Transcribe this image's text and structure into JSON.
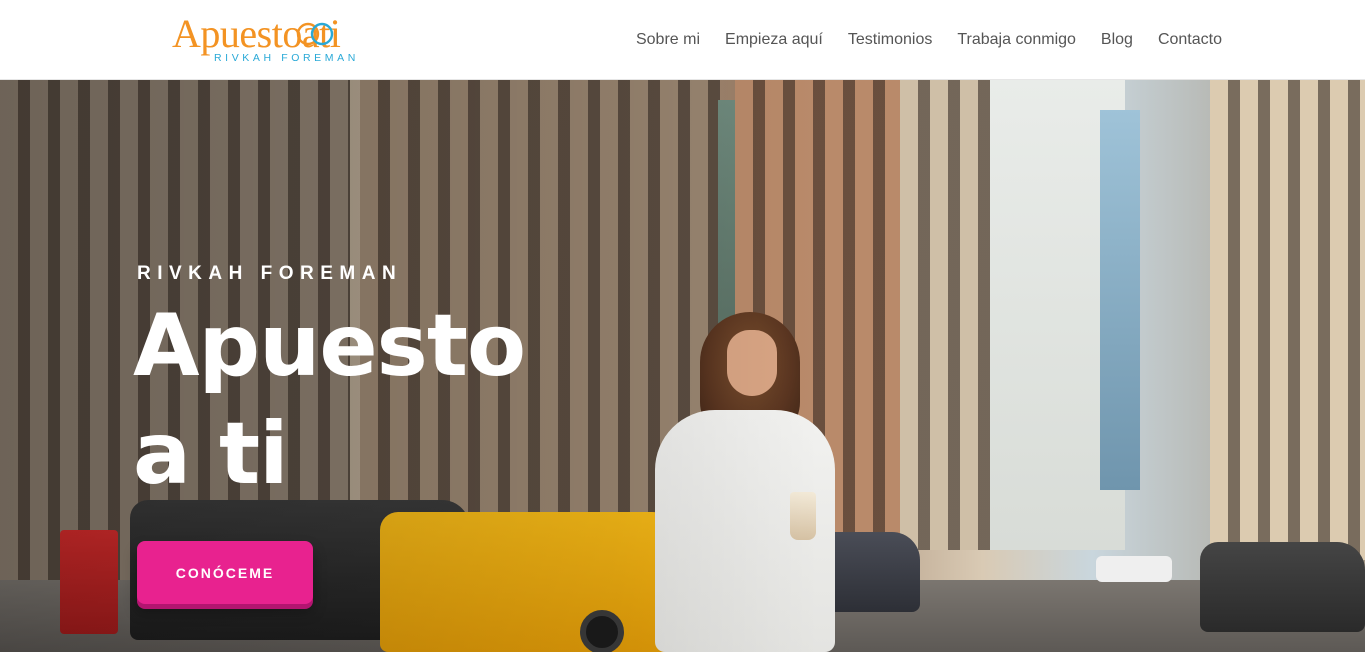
{
  "header": {
    "logo": {
      "main": "Apuestoati",
      "sub": "RIVKAH FOREMAN"
    },
    "nav": [
      {
        "label": "Sobre mi"
      },
      {
        "label": "Empieza aquí"
      },
      {
        "label": "Testimonios"
      },
      {
        "label": "Trabaja conmigo"
      },
      {
        "label": "Blog"
      },
      {
        "label": "Contacto"
      }
    ]
  },
  "hero": {
    "kicker": "RIVKAH FOREMAN",
    "title_line1": "Apuesto",
    "title_line2": "a ti",
    "cta_label": "CONÓCEME"
  },
  "colors": {
    "logo_orange": "#f39323",
    "logo_blue": "#29a9d7",
    "cta_pink": "#e8228f",
    "nav_text": "#555555"
  }
}
